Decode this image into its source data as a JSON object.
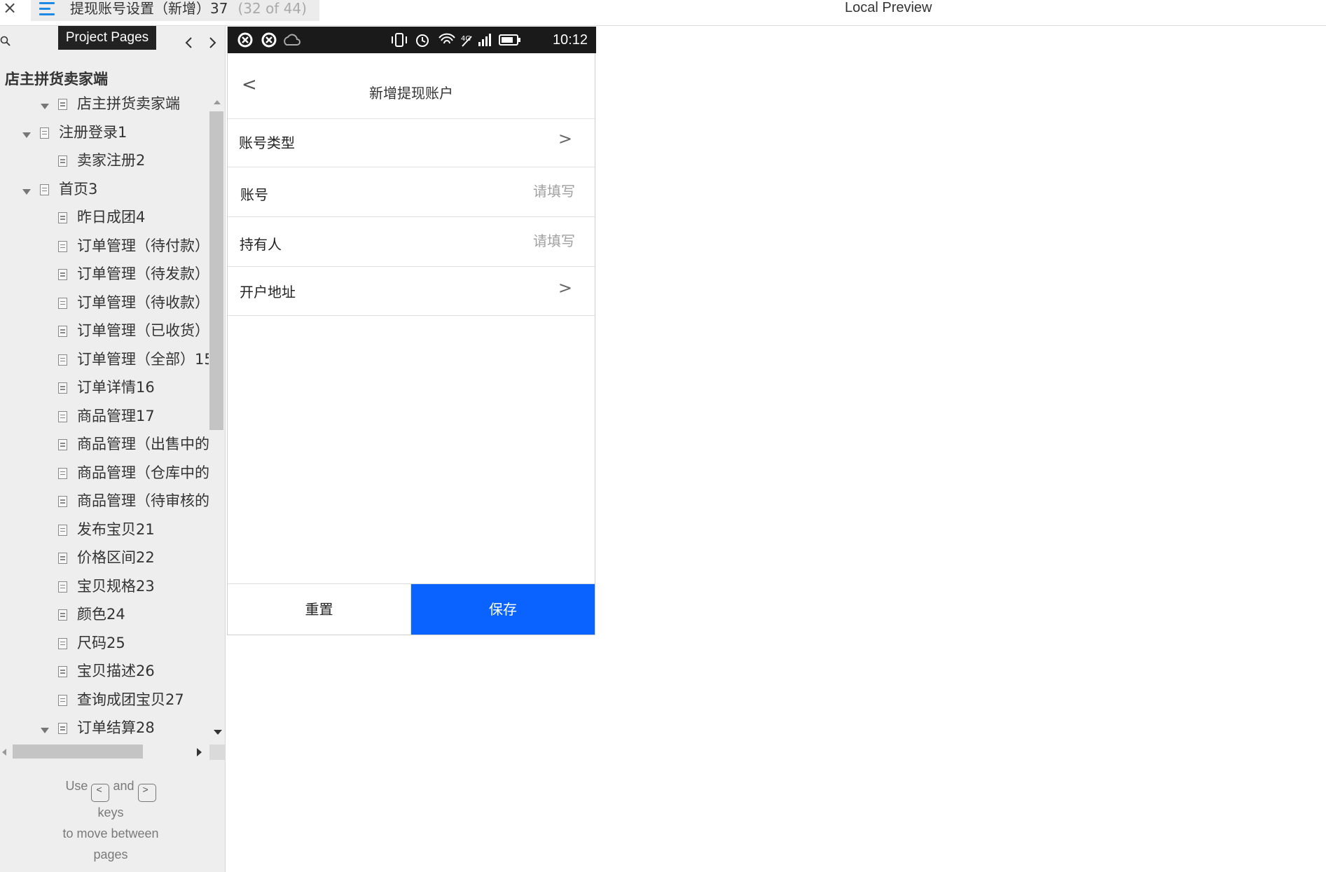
{
  "topbar": {
    "close_label": "×",
    "page_title": "提现账号设置（新增）37",
    "page_counter": "(32 of 44)",
    "preview_label": "Local Preview"
  },
  "sidebar": {
    "tooltip": "Project Pages",
    "project_name": "店主拼货卖家端",
    "tree": [
      {
        "label": "店主拼货卖家端",
        "level": 0,
        "expanded": true
      },
      {
        "label": "注册登录1",
        "level": 1,
        "expanded": true
      },
      {
        "label": "卖家注册2",
        "level": 2
      },
      {
        "label": "首页3",
        "level": 1,
        "expanded": true
      },
      {
        "label": "昨日成团4",
        "level": 2
      },
      {
        "label": "订单管理（待付款）",
        "level": 2
      },
      {
        "label": "订单管理（待发款）",
        "level": 2
      },
      {
        "label": "订单管理（待收款）",
        "level": 2
      },
      {
        "label": "订单管理（已收货）",
        "level": 2
      },
      {
        "label": "订单管理（全部）15",
        "level": 2
      },
      {
        "label": "订单详情16",
        "level": 2
      },
      {
        "label": "商品管理17",
        "level": 2
      },
      {
        "label": "商品管理（出售中的",
        "level": 2
      },
      {
        "label": "商品管理（仓库中的",
        "level": 2
      },
      {
        "label": "商品管理（待审核的",
        "level": 2
      },
      {
        "label": "发布宝贝21",
        "level": 2
      },
      {
        "label": "价格区间22",
        "level": 2
      },
      {
        "label": "宝贝规格23",
        "level": 2
      },
      {
        "label": "颜色24",
        "level": 2
      },
      {
        "label": "尺码25",
        "level": 2
      },
      {
        "label": "宝贝描述26",
        "level": 2
      },
      {
        "label": "查询成团宝贝27",
        "level": 2
      },
      {
        "label": "订单结算28",
        "level": 2,
        "expanded": true
      }
    ],
    "key_hint": {
      "use": "Use",
      "prev_key": "<",
      "and": "and",
      "next_key": ">",
      "keys": "keys",
      "to_move": "to move between",
      "pages": "pages"
    }
  },
  "phone": {
    "status_time": "10:12",
    "nav_back": "<",
    "nav_title": "新增提现账户",
    "form": {
      "account_type_label": "账号类型",
      "account_label": "账号",
      "account_placeholder": "请填写",
      "holder_label": "持有人",
      "holder_placeholder": "请填写",
      "bank_address_label": "开户地址",
      "arrow": ">"
    },
    "reset_label": "重置",
    "save_label": "保存"
  },
  "colors": {
    "accent": "#0b63ff",
    "menu_icon": "#1e88e5",
    "statusbar": "#1a1a1a"
  }
}
